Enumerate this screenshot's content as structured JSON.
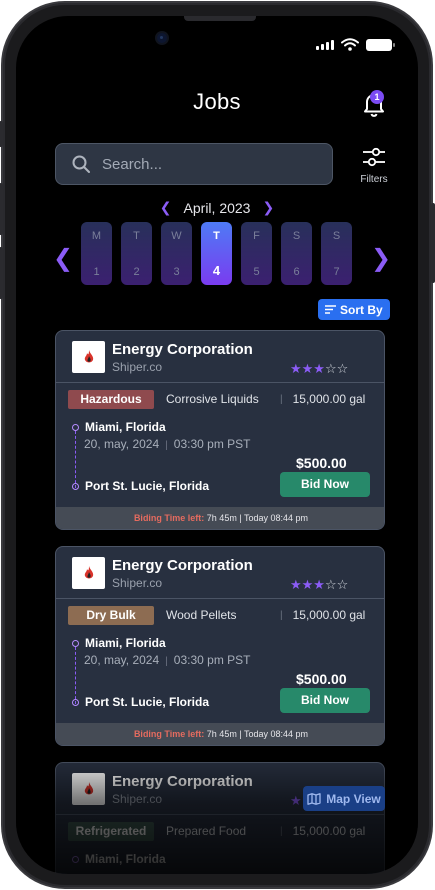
{
  "header": {
    "title": "Jobs",
    "notification_count": "1"
  },
  "search": {
    "placeholder": "Search...",
    "filters_label": "Filters"
  },
  "calendar": {
    "month_label": "April, 2023",
    "days": [
      {
        "letter": "M",
        "number": "1"
      },
      {
        "letter": "T",
        "number": "2"
      },
      {
        "letter": "W",
        "number": "3"
      },
      {
        "letter": "T",
        "number": "4"
      },
      {
        "letter": "F",
        "number": "5"
      },
      {
        "letter": "S",
        "number": "6"
      },
      {
        "letter": "S",
        "number": "7"
      }
    ],
    "selected_index": 3
  },
  "sort_label": "Sort By",
  "jobs": [
    {
      "company": "Energy Corporation",
      "shipper": "Shiper.co",
      "rating": 3,
      "max_rating": 5,
      "category": "Hazardous",
      "cargo": "Corrosive Liquids",
      "quantity": "15,000.00 gal",
      "origin": "Miami, Florida",
      "pickup": "20, may, 2024",
      "pickup_time": "03:30 pm PST",
      "destination": "Port St. Lucie, Florida",
      "price": "$500.00",
      "bid_label": "Bid Now",
      "time_left_label": "Biding Time left:",
      "time_left_value": "7h 45m | Today 08:44 pm"
    },
    {
      "company": "Energy Corporation",
      "shipper": "Shiper.co",
      "rating": 3,
      "max_rating": 5,
      "category": "Dry Bulk",
      "cargo": "Wood Pellets",
      "quantity": "15,000.00 gal",
      "origin": "Miami, Florida",
      "pickup": "20, may, 2024",
      "pickup_time": "03:30 pm PST",
      "destination": "Port St. Lucie, Florida",
      "price": "$500.00",
      "bid_label": "Bid Now",
      "time_left_label": "Biding Time left:",
      "time_left_value": "7h 45m | Today 08:44 pm"
    },
    {
      "company": "Energy Corporation",
      "shipper": "Shiper.co",
      "category": "Refrigerated",
      "cargo": "Prepared Food",
      "quantity": "15,000.00 gal",
      "origin": "Miami, Florida"
    }
  ],
  "map_view_label": "Map View",
  "colors": {
    "accent": "#8b5cf6",
    "bid": "#27896a",
    "sort": "#2a6ff0",
    "hazardous": "#8f4a4e",
    "dry_bulk": "#8d6c52",
    "refrigerated": "#3e5a52"
  }
}
